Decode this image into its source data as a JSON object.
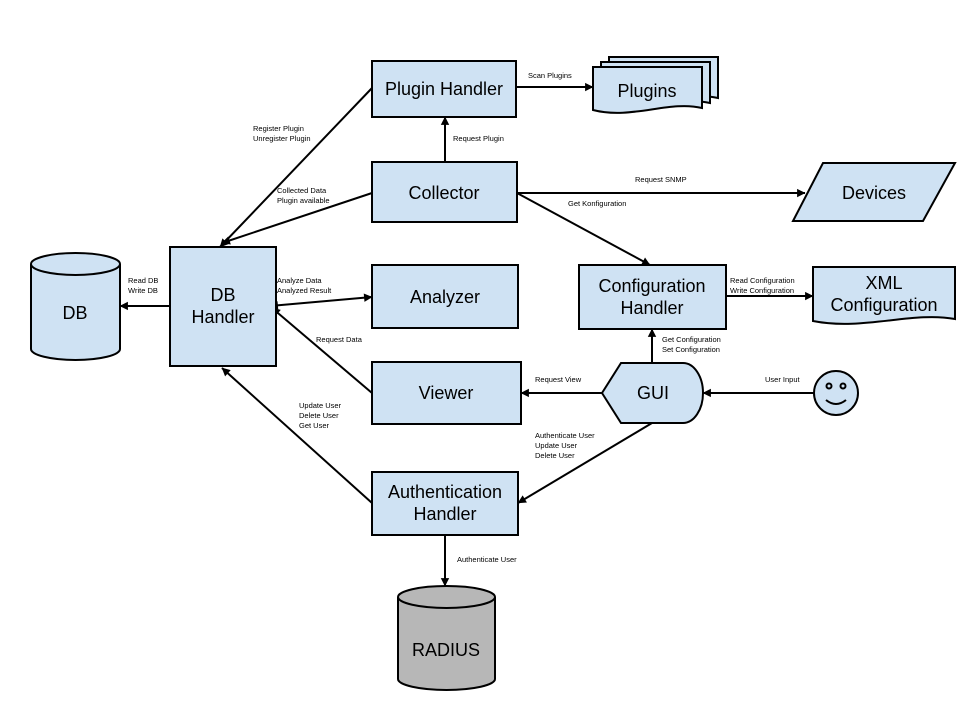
{
  "colors": {
    "node_fill": "#cfe2f3",
    "radius_fill": "#b7b7b7",
    "stroke": "#000000"
  },
  "nodes": {
    "plugin_handler": [
      "Plugin Handler"
    ],
    "plugins": [
      "Plugins"
    ],
    "collector": [
      "Collector"
    ],
    "devices": [
      "Devices"
    ],
    "db": [
      "DB"
    ],
    "db_handler": [
      "DB",
      "Handler"
    ],
    "analyzer": [
      "Analyzer"
    ],
    "config_handler": [
      "Configuration",
      "Handler"
    ],
    "xml_config": [
      "XML",
      "Configuration"
    ],
    "viewer": [
      "Viewer"
    ],
    "gui": [
      "GUI"
    ],
    "user": [],
    "auth_handler": [
      "Authentication",
      "Handler"
    ],
    "radius": [
      "RADIUS"
    ]
  },
  "edges": {
    "scan_plugins": [
      "Scan Plugins"
    ],
    "request_plugin": [
      "Request Plugin"
    ],
    "register_plugin": [
      "Register Plugin",
      "Unregister Plugin"
    ],
    "collected_data": [
      "Collected Data",
      "Plugin available"
    ],
    "request_snmp": [
      "Request SNMP"
    ],
    "get_konfiguration": [
      "Get Konfiguration"
    ],
    "read_db": [
      "Read DB",
      "Write DB"
    ],
    "analyze_data": [
      "Analyze Data",
      "Analyzed Result"
    ],
    "request_data": [
      "Request Data"
    ],
    "read_config": [
      "Read Configuration",
      "Write Configuration"
    ],
    "get_config": [
      "Get Configuration",
      "Set Configuration"
    ],
    "request_view": [
      "Request View"
    ],
    "user_input": [
      "User Input"
    ],
    "authenticate_update": [
      "Authenticate User",
      "Update User",
      "Delete User"
    ],
    "update_user": [
      "Update User",
      "Delete User",
      "Get User"
    ],
    "authenticate_user": [
      "Authenticate User"
    ]
  }
}
